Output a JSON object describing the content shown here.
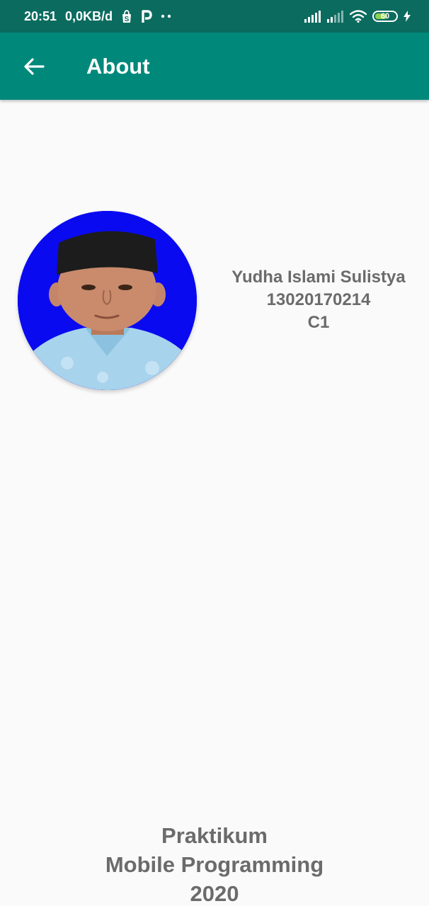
{
  "status_bar": {
    "time": "20:51",
    "network_speed": "0,0KB/d",
    "notification_icons": [
      "shopee-icon",
      "p-icon",
      "more-dots-icon"
    ],
    "battery_level": "60",
    "battery_percent": 60,
    "charging": true,
    "background_color": "#0b6b5f"
  },
  "app_bar": {
    "title": "About",
    "back_icon": "arrow-left-icon",
    "background_color": "#00897b"
  },
  "profile": {
    "name": "Yudha Islami Sulistya",
    "student_id": "13020170214",
    "class": "C1",
    "photo_background_color": "#0a0af0"
  },
  "footer": {
    "line1": "Praktikum",
    "line2": "Mobile Programming",
    "line3": "2020"
  }
}
